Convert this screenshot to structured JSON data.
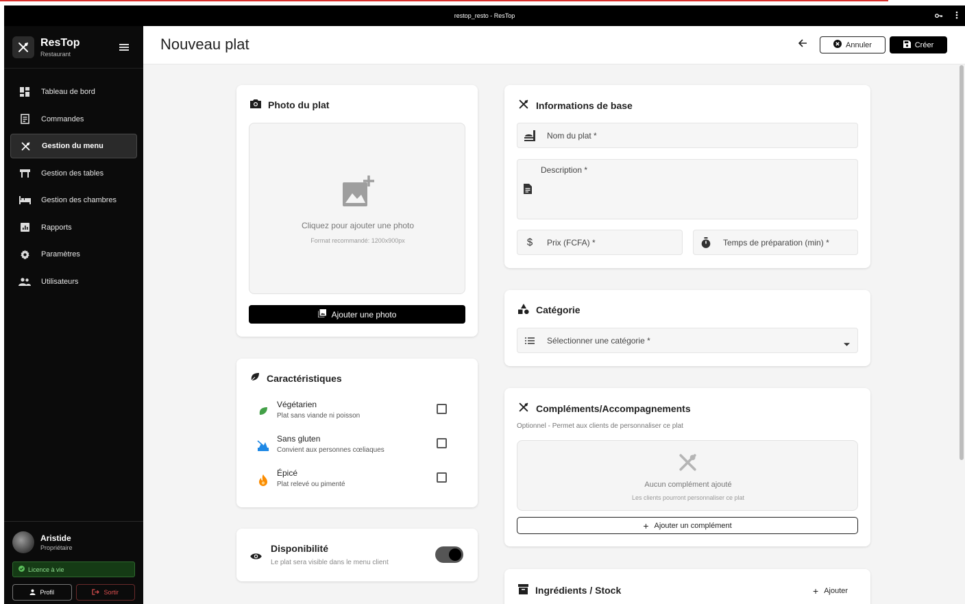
{
  "window": {
    "title": "restop_resto - ResTop"
  },
  "sidebar": {
    "brand": {
      "title": "ResTop",
      "subtitle": "Restaurant"
    },
    "items": [
      {
        "label": "Tableau de bord",
        "icon": "dashboard-icon"
      },
      {
        "label": "Commandes",
        "icon": "receipt-icon"
      },
      {
        "label": "Gestion du menu",
        "icon": "utensils-icon",
        "active": true
      },
      {
        "label": "Gestion des tables",
        "icon": "table-icon"
      },
      {
        "label": "Gestion des chambres",
        "icon": "bed-icon"
      },
      {
        "label": "Rapports",
        "icon": "report-icon"
      },
      {
        "label": "Paramètres",
        "icon": "gear-icon"
      },
      {
        "label": "Utilisateurs",
        "icon": "users-icon"
      }
    ],
    "user": {
      "name": "Aristide",
      "role": "Propriétaire",
      "licence": "Licence à vie"
    },
    "buttons": {
      "profil": "Profil",
      "sortir": "Sortir"
    }
  },
  "header": {
    "title": "Nouveau plat",
    "cancel_label": "Annuler",
    "create_label": "Créer"
  },
  "photo": {
    "title": "Photo du plat",
    "drop_text": "Cliquez pour ajouter une photo",
    "drop_hint": "Format recommandé: 1200x900px",
    "add_button": "Ajouter une photo"
  },
  "characteristics": {
    "title": "Caractéristiques",
    "items": [
      {
        "title": "Végétarien",
        "subtitle": "Plat sans viande ni poisson",
        "checked": false,
        "icon": "leaf-icon",
        "color": "#43a047"
      },
      {
        "title": "Sans gluten",
        "subtitle": "Convient aux personnes cœliaques",
        "checked": false,
        "icon": "no-gluten-icon",
        "color": "#1e88e5"
      },
      {
        "title": "Épicé",
        "subtitle": "Plat relevé ou pimenté",
        "checked": false,
        "icon": "fire-icon",
        "color": "#fb8c00"
      }
    ]
  },
  "availability": {
    "title": "Disponibilité",
    "subtitle": "Le plat sera visible dans le menu client",
    "enabled": true
  },
  "basic_info": {
    "title": "Informations de base",
    "name_placeholder": "Nom du plat *",
    "description_placeholder": "Description *",
    "price_placeholder": "Prix (FCFA) *",
    "prep_placeholder": "Temps de préparation (min) *"
  },
  "category": {
    "title": "Catégorie",
    "select_placeholder": "Sélectionner une catégorie *"
  },
  "complements": {
    "title": "Compléments/Accompagnements",
    "subtitle": "Optionnel - Permet aux clients de personnaliser ce plat",
    "empty_title": "Aucun complément ajouté",
    "empty_hint": "Les clients pourront personnaliser ce plat",
    "add_button": "Ajouter un complément"
  },
  "ingredients": {
    "title": "Ingrédients / Stock",
    "add_label": "Ajouter"
  },
  "colors": {
    "sidebar_bg": "#0b0b0b",
    "accent": "#000000",
    "content_bg": "#f4f4f4",
    "licence_green": "#8fe08f"
  }
}
